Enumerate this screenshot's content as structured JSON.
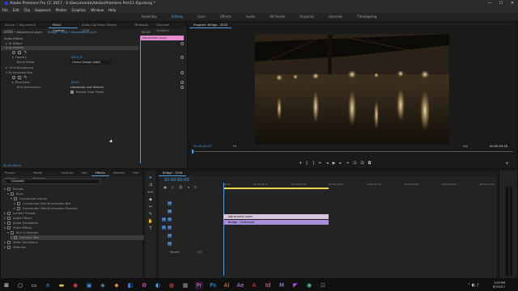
{
  "window": {
    "title": "Adobe Premiere Pro CC 2017 - E:\\Documents\\Adobe\\Premiere Pro\\11.0\\pulsing *",
    "minimize": "—",
    "maximize": "☐",
    "close": "✕"
  },
  "menu": [
    "File",
    "Edit",
    "Clip",
    "Sequence",
    "Marker",
    "Graphics",
    "Window",
    "Help"
  ],
  "workspaces": [
    "Assembly",
    "Editing",
    "Color",
    "Effects",
    "Audio",
    "All Panels",
    "Graphics",
    "Libraries",
    "Timelapsing"
  ],
  "workspace_active": "Editing",
  "source_panel": {
    "tabs": [
      "Source: * Adjustment Layer",
      "Effect Controls",
      "Audio Clip Mixer: Bridge - 3228",
      "Metadata",
      "Essential Graphics"
    ],
    "active_tab": "Effect Controls",
    "header_source": "Source * Adjustment Layer",
    "header_clip": "Bridge - 3228 * Adjustment Layer",
    "ruler_time": "00:00",
    "clip_label": "Adjustment Layer",
    "timecode": "00:00:00:00"
  },
  "effects": {
    "video_effects_label": "Video Effects",
    "motion": "Motion",
    "opacity": "Opacity",
    "opacity_prop": "Opacity",
    "opacity_value": "100.0 %",
    "blend_mode": "Blend Mode",
    "blend_value": "Linear Dodge (Add)",
    "time_remap": "Time Remapping",
    "gaussian": "Gaussian Blur",
    "blurriness": "Blurriness",
    "blurriness_value": "100.0",
    "blur_dim": "Blur Dimensions",
    "blur_dim_value": "Horizontal and Vertical",
    "repeat_edge": "Repeat Edge Pixels"
  },
  "program": {
    "title": "Program: Bridge - 3228",
    "timecode": "00:00:00:00",
    "fit": "Fit",
    "quality": "Full",
    "duration": "00:00:03:28"
  },
  "effects_panel": {
    "tabs": [
      "Project: pulsing",
      "Media Browser",
      "Libraries",
      "Info",
      "Effects",
      "Markers",
      "Hist"
    ],
    "active_tab": "Effects",
    "search": "Gaussian",
    "items": [
      {
        "label": "Presets",
        "indent": 1,
        "open": true
      },
      {
        "label": "Blurs",
        "indent": 2,
        "open": true
      },
      {
        "label": "Convolution Kernel",
        "indent": 3,
        "open": true
      },
      {
        "label": "Convolution Kernel Gaussian Blur",
        "indent": 4,
        "open": false
      },
      {
        "label": "Convolution Kernel Gaussian Sharpen",
        "indent": 4,
        "open": false
      },
      {
        "label": "Lumetri Presets",
        "indent": 1,
        "open": false
      },
      {
        "label": "Audio Effects",
        "indent": 1,
        "open": false
      },
      {
        "label": "Audio Transitions",
        "indent": 1,
        "open": false
      },
      {
        "label": "Video Effects",
        "indent": 1,
        "open": true
      },
      {
        "label": "Blur & Sharpen",
        "indent": 2,
        "open": true
      },
      {
        "label": "Gaussian Blur",
        "indent": 3,
        "open": false,
        "selected": true
      },
      {
        "label": "Video Transitions",
        "indent": 1,
        "open": false
      },
      {
        "label": "Favorites",
        "indent": 1,
        "open": false
      }
    ]
  },
  "timeline": {
    "tab": "Bridge - 3228",
    "timecode": "00:00:00:00",
    "ruler": [
      "00:00",
      "00:00:04:23",
      "00:00:09:23",
      "00:00:14:23",
      "00:00:19:23",
      "00:00:24:23",
      "00:00:29:23",
      "00:00:34:23"
    ],
    "video_tracks": [
      "V3",
      "V2",
      "V1"
    ],
    "audio_tracks": [
      "A1",
      "A2",
      "A3"
    ],
    "master": "Master",
    "master_val": "0.0",
    "clips": [
      {
        "name": "Adjustment Layer",
        "track": "V2"
      },
      {
        "name": "Bridge - 3228.mp4",
        "track": "V1"
      }
    ]
  },
  "taskbar": {
    "time": "3:29 PM",
    "date": "8/7/2017"
  }
}
